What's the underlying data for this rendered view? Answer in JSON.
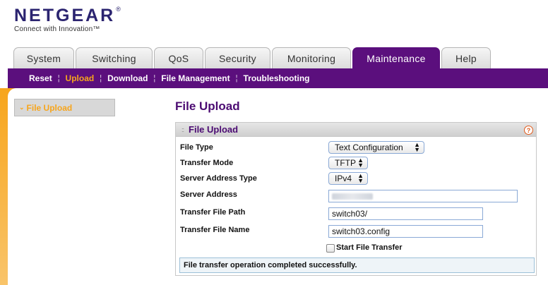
{
  "brand": {
    "name": "NETGEAR",
    "trademark": "®",
    "tagline": "Connect with Innovation™"
  },
  "tabs": [
    {
      "label": "System"
    },
    {
      "label": "Switching"
    },
    {
      "label": "QoS"
    },
    {
      "label": "Security"
    },
    {
      "label": "Monitoring"
    },
    {
      "label": "Maintenance",
      "active": true
    },
    {
      "label": "Help"
    }
  ],
  "subnav": [
    {
      "label": "Reset"
    },
    {
      "label": "Upload",
      "active": true
    },
    {
      "label": "Download"
    },
    {
      "label": "File Management"
    },
    {
      "label": "Troubleshooting"
    }
  ],
  "sidebar": {
    "items": [
      {
        "label": "File Upload",
        "active": true
      }
    ]
  },
  "page": {
    "title": "File Upload"
  },
  "panel": {
    "title": "File Upload",
    "help_icon": "help-icon",
    "fields": {
      "file_type": {
        "label": "File Type",
        "value": "Text Configuration"
      },
      "transfer_mode": {
        "label": "Transfer Mode",
        "value": "TFTP"
      },
      "server_address_type": {
        "label": "Server Address Type",
        "value": "IPv4"
      },
      "server_address": {
        "label": "Server Address",
        "value": ""
      },
      "transfer_file_path": {
        "label": "Transfer File Path",
        "value": "switch03/"
      },
      "transfer_file_name": {
        "label": "Transfer File Name",
        "value": "switch03.config"
      }
    },
    "start_transfer": {
      "label": "Start File Transfer",
      "checked": false
    },
    "status_message": "File transfer operation completed successfully."
  },
  "colors": {
    "brand_purple": "#5b0f7d",
    "accent_orange": "#f7a51c",
    "title_purple": "#4b0b72"
  }
}
